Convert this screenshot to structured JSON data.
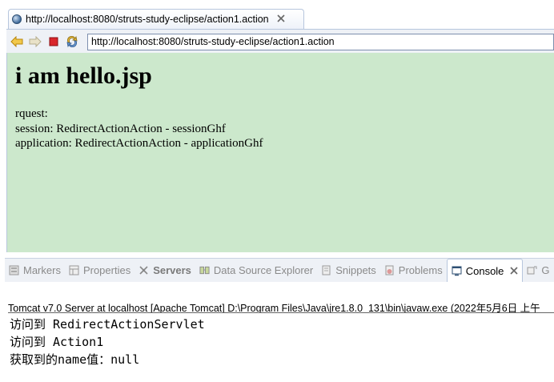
{
  "editor_tab": {
    "title": "http://localhost:8080/struts-study-eclipse/action1.action",
    "close": "⛝"
  },
  "toolbar": {
    "back_icon": "back-arrow-icon",
    "forward_icon": "forward-arrow-icon",
    "stop_icon": "stop-icon",
    "refresh_icon": "refresh-icon",
    "url": "http://localhost:8080/struts-study-eclipse/action1.action"
  },
  "page": {
    "heading": "i am hello.jsp",
    "request_line": "rquest:",
    "session_line": "session: RedirectActionAction - sessionGhf",
    "application_line": "application: RedirectActionAction - applicationGhf",
    "background": "#cce8cc"
  },
  "views": {
    "tabs": [
      {
        "label": "Markers",
        "icon": "markers-icon"
      },
      {
        "label": "Properties",
        "icon": "properties-icon"
      },
      {
        "label": "Servers",
        "icon": "servers-icon"
      },
      {
        "label": "Data Source Explorer",
        "icon": "data-source-icon"
      },
      {
        "label": "Snippets",
        "icon": "snippets-icon"
      },
      {
        "label": "Problems",
        "icon": "problems-icon"
      },
      {
        "label": "Console",
        "icon": "console-icon",
        "active": true
      },
      {
        "label": "G",
        "icon": "git-icon"
      }
    ]
  },
  "console": {
    "header": "Tomcat v7.0 Server at localhost [Apache Tomcat] D:\\Program Files\\Java\\jre1.8.0_131\\bin\\javaw.exe (2022年5月6日 上午",
    "lines": [
      "访问到 RedirectActionServlet",
      "访问到 Action1",
      "获取到的name值：null"
    ]
  }
}
